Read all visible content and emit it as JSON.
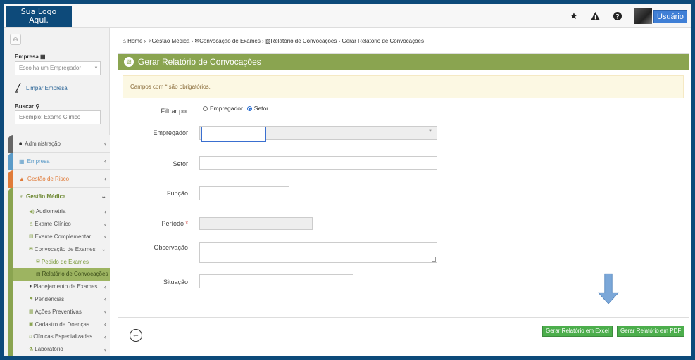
{
  "header": {
    "logo": [
      "Sua Logo",
      "Aqui."
    ],
    "icons": [
      "star-icon",
      "warning-icon",
      "help-icon"
    ],
    "user_label": "Usuário"
  },
  "sidebar": {
    "empresa_label": "Empresa",
    "empresa_placeholder": "Escolha um Empregador",
    "clear_label": "Limpar Empresa",
    "search_label": "Buscar",
    "search_placeholder": "Exemplo: Exame Clínico",
    "menu": [
      {
        "label": "Administração",
        "color": "#666666",
        "icon": "lock-icon"
      },
      {
        "label": "Empresa",
        "color": "#5b9bc8",
        "icon": "building-icon"
      },
      {
        "label": "Gestão de Risco",
        "color": "#e07b39",
        "icon": "warning-icon"
      },
      {
        "label": "Gestão Médica",
        "color": "#8aa450",
        "icon": "stethoscope-icon"
      }
    ],
    "submenu": [
      {
        "label": "Audiometria",
        "icon": "audio-icon"
      },
      {
        "label": "Exame Clínico",
        "icon": "user-icon"
      },
      {
        "label": "Exame Complementar",
        "icon": "file-icon"
      },
      {
        "label": "Convocação de Exames",
        "icon": "envelope-icon"
      },
      {
        "label": "Pedido de Exames",
        "icon": "envelope-icon"
      },
      {
        "label": "Relatório de Convocações",
        "icon": "report-icon"
      },
      {
        "label": "Planejamento de Exames",
        "icon": "chart-icon"
      },
      {
        "label": "Pendências",
        "icon": "flag-icon"
      },
      {
        "label": "Ações Preventivas",
        "icon": "list-icon"
      },
      {
        "label": "Cadastro de Doenças",
        "icon": "medkit-icon"
      },
      {
        "label": "Clínicas Especializadas",
        "icon": "hospital-icon"
      },
      {
        "label": "Laboratório",
        "icon": "flask-icon"
      }
    ]
  },
  "breadcrumb": {
    "home": "Home",
    "gestao": "Gestão Médica",
    "convocacao": "Convocação de Exames",
    "relatorio": "Relatório de Convocações",
    "current": "Gerar Relatório de Convocações"
  },
  "panel": {
    "title": "Gerar Relatório de Convocações",
    "alert": "Campos com * são obrigatórios.",
    "filter_label": "Filtrar por",
    "filter_options": [
      "Empregador",
      "Setor"
    ],
    "filter_selected": "Setor",
    "fields": {
      "empregador": "Empregador",
      "setor": "Setor",
      "funcao": "Função",
      "periodo": "Período",
      "observacao": "Observação",
      "situacao": "Situação"
    },
    "btn_excel": "Gerar Relatório em Excel",
    "btn_pdf": "Gerar Relatório em PDF"
  }
}
